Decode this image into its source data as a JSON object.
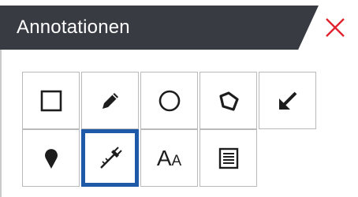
{
  "panel": {
    "title": "Annotationen"
  },
  "colors": {
    "titlebar": "#383b42",
    "close_icon": "#e0242f",
    "icon": "#1d1d1d",
    "selected_border": "#1f5aa8",
    "tile_border": "#b9b9b9"
  },
  "tools": {
    "rectangle": {
      "icon": "rectangle-icon"
    },
    "pencil": {
      "icon": "pencil-icon"
    },
    "ellipse": {
      "icon": "circle-icon"
    },
    "polygon": {
      "icon": "polygon-icon"
    },
    "arrow": {
      "icon": "arrow-icon"
    },
    "marker": {
      "icon": "map-pin-icon"
    },
    "measure": {
      "icon": "measure-tool-icon",
      "selected": true
    },
    "text": {
      "icon": "text-icon",
      "big": "A",
      "small": "A"
    },
    "note": {
      "icon": "note-icon"
    }
  }
}
